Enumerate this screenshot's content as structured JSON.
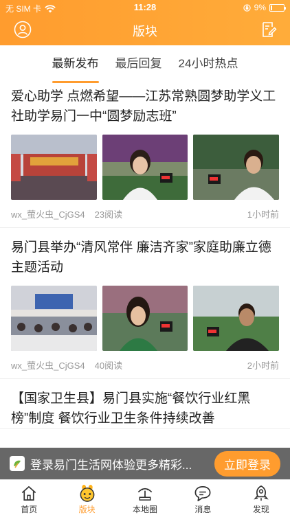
{
  "status_bar": {
    "carrier": "无 SIM 卡",
    "time": "11:28",
    "battery": "9%",
    "battery_level": 0.09
  },
  "header": {
    "title": "版块"
  },
  "tabs": [
    {
      "label": "最新发布",
      "active": true
    },
    {
      "label": "最后回复",
      "active": false
    },
    {
      "label": "24小时热点",
      "active": false
    }
  ],
  "posts": [
    {
      "title": "爱心助学 点燃希望——江苏常熟圆梦助学义工社助学易门一中“圆梦励志班”",
      "author": "wx_萤火虫_CjGS4",
      "views": "23阅读",
      "time": "1小时前"
    },
    {
      "title": "易门县举办“清风常伴 廉洁齐家”家庭助廉立德主题活动",
      "author": "wx_萤火虫_CjGS4",
      "views": "40阅读",
      "time": "2小时前"
    },
    {
      "title": "【国家卫生县】易门县实施“餐饮行业红黑榜”制度 餐饮行业卫生条件持续改善",
      "author": "",
      "views": "",
      "time": ""
    }
  ],
  "login_banner": {
    "text": "登录易门生活网体验更多精彩...",
    "button": "立即登录"
  },
  "tabbar": [
    {
      "label": "首页",
      "icon": "home-icon",
      "active": false
    },
    {
      "label": "版块",
      "icon": "forum-icon",
      "active": true
    },
    {
      "label": "本地圈",
      "icon": "local-circle-icon",
      "active": false
    },
    {
      "label": "消息",
      "icon": "message-icon",
      "active": false
    },
    {
      "label": "发现",
      "icon": "discover-icon",
      "active": false
    }
  ],
  "colors": {
    "accent": "#ff9c2e",
    "header_gradient_end": "#ffac3a"
  }
}
